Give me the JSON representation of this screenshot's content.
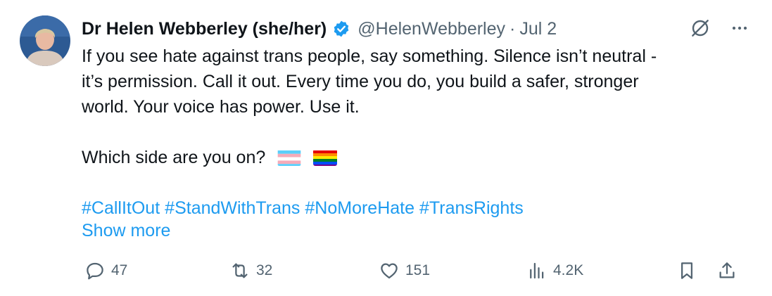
{
  "tweet": {
    "display_name": "Dr Helen Webberley (she/her)",
    "handle": "@HelenWebberley",
    "separator": "·",
    "date": "Jul 2",
    "body_lines": [
      "If you see hate against trans people, say something. Silence isn’t neutral -",
      "it’s permission. Call it out. Every time you do, you build a safer, stronger",
      "world. Your voice has power. Use it."
    ],
    "question": "Which side are you on?",
    "hashtags": [
      "#CallItOut",
      "#StandWithTrans",
      "#NoMoreHate",
      "#TransRights"
    ],
    "show_more": "Show more"
  },
  "actions": {
    "replies": "47",
    "reposts": "32",
    "likes": "151",
    "views": "4.2K"
  },
  "icons": {
    "verified": "verified-badge-icon",
    "grok": "grok-icon",
    "more": "more-icon",
    "reply": "reply-icon",
    "repost": "repost-icon",
    "like": "heart-icon",
    "views": "analytics-icon",
    "bookmark": "bookmark-icon",
    "share": "share-icon",
    "trans_flag": "transgender-flag-icon",
    "rainbow_flag": "rainbow-flag-icon"
  },
  "colors": {
    "text": "#0f1419",
    "secondary": "#536471",
    "link": "#1d9bf0",
    "verified": "#1d9bf0"
  }
}
